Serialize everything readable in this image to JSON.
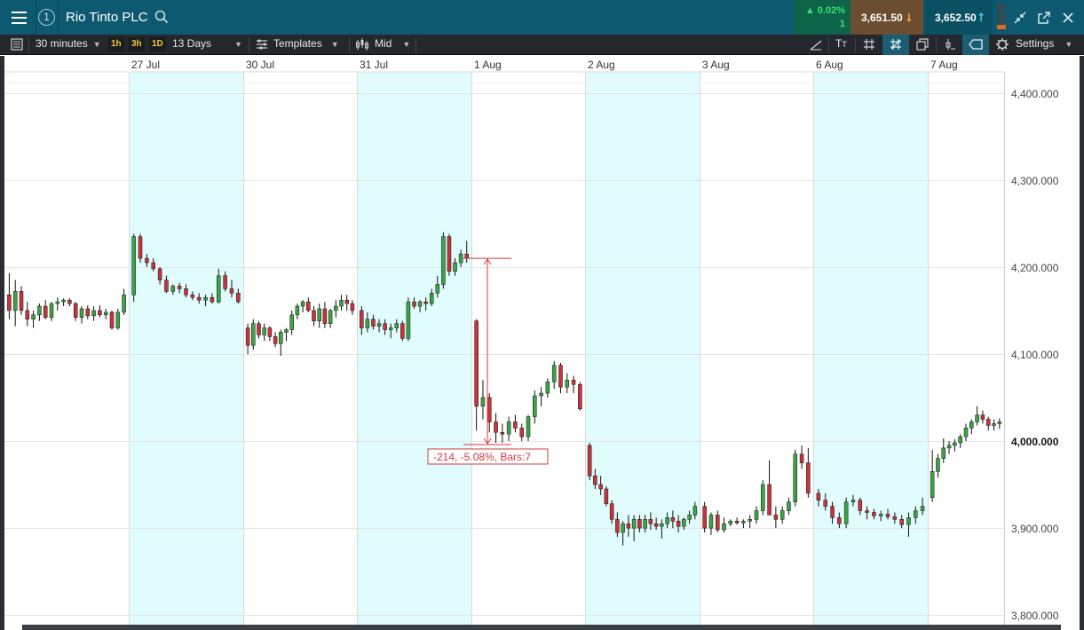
{
  "header": {
    "window_number": "1",
    "instrument": "Rio Tinto PLC",
    "change_pct": "0.02%",
    "change_points": "1",
    "sell_price": "3,651.50",
    "buy_price": "3,652.50"
  },
  "toolbar": {
    "interval": "30 minutes",
    "quick_1": "1h",
    "quick_2": "3h",
    "quick_3": "1D",
    "range": "13 Days",
    "templates": "Templates",
    "price_type": "Mid",
    "settings": "Settings"
  },
  "colors": {
    "up": "#3aa546",
    "down": "#c8343d",
    "shade": "#e0fcfd",
    "grid": "#e4e4e4",
    "measure": "#d43b3b",
    "header_bg": "#0d5a70",
    "toolbar_bg": "#24282c"
  },
  "chart_data": {
    "type": "candlestick",
    "x_tick_labels": [
      "27 Jul",
      "30 Jul",
      "31 Jul",
      "1 Aug",
      "2 Aug",
      "3 Aug",
      "6 Aug",
      "7 Aug"
    ],
    "y_ticks": [
      3800,
      3900,
      4000,
      4100,
      4200,
      4300,
      4400
    ],
    "y_tick_labels": [
      "3,800.000",
      "3,900.000",
      "4,000.000",
      "4,100.000",
      "4,200.000",
      "4,300.000",
      "4,400.000"
    ],
    "y_highlight": "4,000.000",
    "ylim": [
      3790,
      4411
    ],
    "shaded_days": [
      1,
      3,
      5,
      7
    ],
    "days": [
      {
        "label": "",
        "candles": [
          [
            4168,
            4193,
            4140,
            4150
          ],
          [
            4150,
            4185,
            4132,
            4172
          ],
          [
            4172,
            4178,
            4145,
            4150
          ],
          [
            4150,
            4160,
            4132,
            4140
          ],
          [
            4140,
            4150,
            4130,
            4145
          ],
          [
            4145,
            4158,
            4138,
            4155
          ],
          [
            4155,
            4162,
            4140,
            4142
          ],
          [
            4142,
            4160,
            4138,
            4158
          ],
          [
            4158,
            4165,
            4150,
            4160
          ],
          [
            4160,
            4164,
            4155,
            4162
          ],
          [
            4162,
            4164,
            4155,
            4158
          ],
          [
            4158,
            4160,
            4138,
            4142
          ],
          [
            4142,
            4155,
            4135,
            4152
          ],
          [
            4152,
            4156,
            4140,
            4144
          ],
          [
            4144,
            4155,
            4138,
            4150
          ],
          [
            4150,
            4156,
            4142,
            4145
          ],
          [
            4145,
            4152,
            4140,
            4148
          ],
          [
            4148,
            4150,
            4128,
            4130
          ],
          [
            4130,
            4152,
            4128,
            4148
          ],
          [
            4148,
            4175,
            4145,
            4168
          ]
        ]
      },
      {
        "label": "27 Jul",
        "candles": [
          [
            4168,
            4238,
            4160,
            4235
          ],
          [
            4235,
            4238,
            4205,
            4210
          ],
          [
            4210,
            4215,
            4200,
            4205
          ],
          [
            4205,
            4210,
            4195,
            4198
          ],
          [
            4198,
            4200,
            4180,
            4185
          ],
          [
            4185,
            4190,
            4170,
            4172
          ],
          [
            4172,
            4180,
            4168,
            4178
          ],
          [
            4178,
            4182,
            4170,
            4175
          ],
          [
            4175,
            4180,
            4165,
            4168
          ],
          [
            4168,
            4172,
            4162,
            4165
          ],
          [
            4165,
            4170,
            4158,
            4162
          ],
          [
            4162,
            4168,
            4155,
            4165
          ],
          [
            4165,
            4170,
            4158,
            4160
          ],
          [
            4160,
            4198,
            4158,
            4190
          ],
          [
            4190,
            4195,
            4172,
            4175
          ],
          [
            4175,
            4185,
            4165,
            4170
          ],
          [
            4170,
            4175,
            4158,
            4160
          ]
        ]
      },
      {
        "label": "30 Jul",
        "candles": [
          [
            4130,
            4135,
            4100,
            4110
          ],
          [
            4110,
            4140,
            4105,
            4135
          ],
          [
            4135,
            4138,
            4118,
            4122
          ],
          [
            4122,
            4135,
            4115,
            4130
          ],
          [
            4130,
            4132,
            4115,
            4120
          ],
          [
            4120,
            4125,
            4108,
            4112
          ],
          [
            4112,
            4128,
            4098,
            4125
          ],
          [
            4125,
            4130,
            4115,
            4128
          ],
          [
            4128,
            4150,
            4122,
            4145
          ],
          [
            4145,
            4158,
            4140,
            4155
          ],
          [
            4155,
            4162,
            4148,
            4160
          ],
          [
            4160,
            4165,
            4148,
            4150
          ],
          [
            4150,
            4155,
            4132,
            4138
          ],
          [
            4138,
            4158,
            4130,
            4152
          ],
          [
            4152,
            4160,
            4130,
            4135
          ],
          [
            4135,
            4152,
            4130,
            4150
          ],
          [
            4150,
            4162,
            4142,
            4155
          ],
          [
            4155,
            4168,
            4150,
            4162
          ],
          [
            4162,
            4168,
            4150,
            4158
          ],
          [
            4158,
            4162,
            4145,
            4150
          ]
        ]
      },
      {
        "label": "31 Jul",
        "candles": [
          [
            4150,
            4155,
            4122,
            4130
          ],
          [
            4130,
            4148,
            4125,
            4140
          ],
          [
            4140,
            4145,
            4128,
            4132
          ],
          [
            4132,
            4140,
            4125,
            4135
          ],
          [
            4135,
            4140,
            4122,
            4128
          ],
          [
            4128,
            4135,
            4118,
            4130
          ],
          [
            4130,
            4140,
            4125,
            4135
          ],
          [
            4135,
            4138,
            4115,
            4118
          ],
          [
            4118,
            4165,
            4115,
            4160
          ],
          [
            4160,
            4165,
            4152,
            4155
          ],
          [
            4155,
            4162,
            4148,
            4160
          ],
          [
            4160,
            4165,
            4150,
            4158
          ],
          [
            4158,
            4175,
            4155,
            4170
          ],
          [
            4170,
            4190,
            4165,
            4180
          ],
          [
            4180,
            4240,
            4175,
            4235
          ],
          [
            4235,
            4238,
            4190,
            4195
          ],
          [
            4195,
            4210,
            4190,
            4205
          ],
          [
            4205,
            4220,
            4200,
            4215
          ],
          [
            4215,
            4230,
            4205,
            4210
          ]
        ]
      },
      {
        "label": "1 Aug",
        "candles": [
          [
            4138,
            4140,
            4012,
            4040
          ],
          [
            4040,
            4070,
            4025,
            4050
          ],
          [
            4050,
            4055,
            4010,
            4022
          ],
          [
            4022,
            4032,
            3998,
            4010
          ],
          [
            4010,
            4020,
            3998,
            4008
          ],
          [
            4008,
            4028,
            4000,
            4022
          ],
          [
            4022,
            4030,
            4010,
            4015
          ],
          [
            4015,
            4020,
            4000,
            4005
          ],
          [
            4005,
            4030,
            4000,
            4028
          ],
          [
            4028,
            4058,
            4020,
            4052
          ],
          [
            4052,
            4062,
            4040,
            4055
          ],
          [
            4055,
            4072,
            4050,
            4068
          ],
          [
            4068,
            4092,
            4060,
            4087
          ],
          [
            4087,
            4090,
            4055,
            4062
          ],
          [
            4062,
            4078,
            4055,
            4070
          ],
          [
            4070,
            4075,
            4055,
            4065
          ],
          [
            4065,
            4068,
            4035,
            4037
          ]
        ]
      },
      {
        "label": "2 Aug",
        "candles": [
          [
            3995,
            3998,
            3955,
            3960
          ],
          [
            3960,
            3968,
            3945,
            3950
          ],
          [
            3950,
            3960,
            3938,
            3945
          ],
          [
            3945,
            3948,
            3925,
            3928
          ],
          [
            3928,
            3932,
            3905,
            3910
          ],
          [
            3910,
            3918,
            3890,
            3895
          ],
          [
            3895,
            3908,
            3880,
            3905
          ],
          [
            3905,
            3915,
            3890,
            3900
          ],
          [
            3900,
            3915,
            3885,
            3910
          ],
          [
            3910,
            3915,
            3895,
            3900
          ],
          [
            3900,
            3915,
            3895,
            3910
          ],
          [
            3910,
            3918,
            3898,
            3905
          ],
          [
            3905,
            3912,
            3898,
            3902
          ],
          [
            3902,
            3910,
            3888,
            3905
          ],
          [
            3905,
            3918,
            3900,
            3912
          ],
          [
            3912,
            3920,
            3900,
            3908
          ],
          [
            3908,
            3915,
            3895,
            3902
          ],
          [
            3902,
            3912,
            3898,
            3910
          ],
          [
            3910,
            3920,
            3905,
            3915
          ],
          [
            3915,
            3930,
            3910,
            3925
          ]
        ]
      },
      {
        "label": "3 Aug",
        "candles": [
          [
            3925,
            3930,
            3895,
            3900
          ],
          [
            3900,
            3918,
            3892,
            3915
          ],
          [
            3915,
            3920,
            3895,
            3898
          ],
          [
            3898,
            3912,
            3895,
            3905
          ],
          [
            3905,
            3910,
            3902,
            3908
          ],
          [
            3908,
            3912,
            3904,
            3906
          ],
          [
            3906,
            3910,
            3900,
            3908
          ],
          [
            3908,
            3915,
            3900,
            3910
          ],
          [
            3910,
            3925,
            3905,
            3920
          ],
          [
            3920,
            3955,
            3915,
            3950
          ],
          [
            3950,
            3978,
            3945,
            3915
          ],
          [
            3915,
            3925,
            3900,
            3910
          ],
          [
            3910,
            3925,
            3905,
            3920
          ],
          [
            3920,
            3935,
            3915,
            3930
          ],
          [
            3930,
            3990,
            3925,
            3985
          ],
          [
            3985,
            3995,
            3968,
            3975
          ],
          [
            3975,
            3992,
            3935,
            3940
          ]
        ]
      },
      {
        "label": "6 Aug",
        "candles": [
          [
            3940,
            3945,
            3925,
            3932
          ],
          [
            3932,
            3940,
            3920,
            3925
          ],
          [
            3925,
            3930,
            3905,
            3912
          ],
          [
            3912,
            3918,
            3900,
            3905
          ],
          [
            3905,
            3935,
            3900,
            3930
          ],
          [
            3930,
            3938,
            3925,
            3932
          ],
          [
            3932,
            3935,
            3915,
            3920
          ],
          [
            3920,
            3925,
            3910,
            3918
          ],
          [
            3918,
            3922,
            3910,
            3914
          ],
          [
            3914,
            3920,
            3908,
            3916
          ],
          [
            3916,
            3922,
            3910,
            3913
          ],
          [
            3913,
            3918,
            3905,
            3910
          ],
          [
            3910,
            3915,
            3900,
            3904
          ],
          [
            3904,
            3918,
            3890,
            3912
          ],
          [
            3912,
            3925,
            3905,
            3920
          ],
          [
            3920,
            3935,
            3915,
            3925
          ]
        ]
      },
      {
        "label": "7 Aug",
        "candles": [
          [
            3935,
            3990,
            3930,
            3965
          ],
          [
            3965,
            3985,
            3958,
            3980
          ],
          [
            3980,
            4003,
            3975,
            3992
          ],
          [
            3992,
            4000,
            3985,
            3995
          ],
          [
            3995,
            4002,
            3988,
            3998
          ],
          [
            3998,
            4008,
            3992,
            4005
          ],
          [
            4005,
            4020,
            4000,
            4015
          ],
          [
            4015,
            4025,
            4008,
            4022
          ],
          [
            4022,
            4040,
            4018,
            4030
          ],
          [
            4030,
            4035,
            4020,
            4025
          ],
          [
            4025,
            4028,
            4012,
            4018
          ],
          [
            4018,
            4025,
            4012,
            4020
          ],
          [
            4020,
            4026,
            4014,
            4022
          ]
        ]
      }
    ],
    "measurement": {
      "label": "-214, -5.08%, Bars:7",
      "from": 4210,
      "to": 3996
    }
  }
}
